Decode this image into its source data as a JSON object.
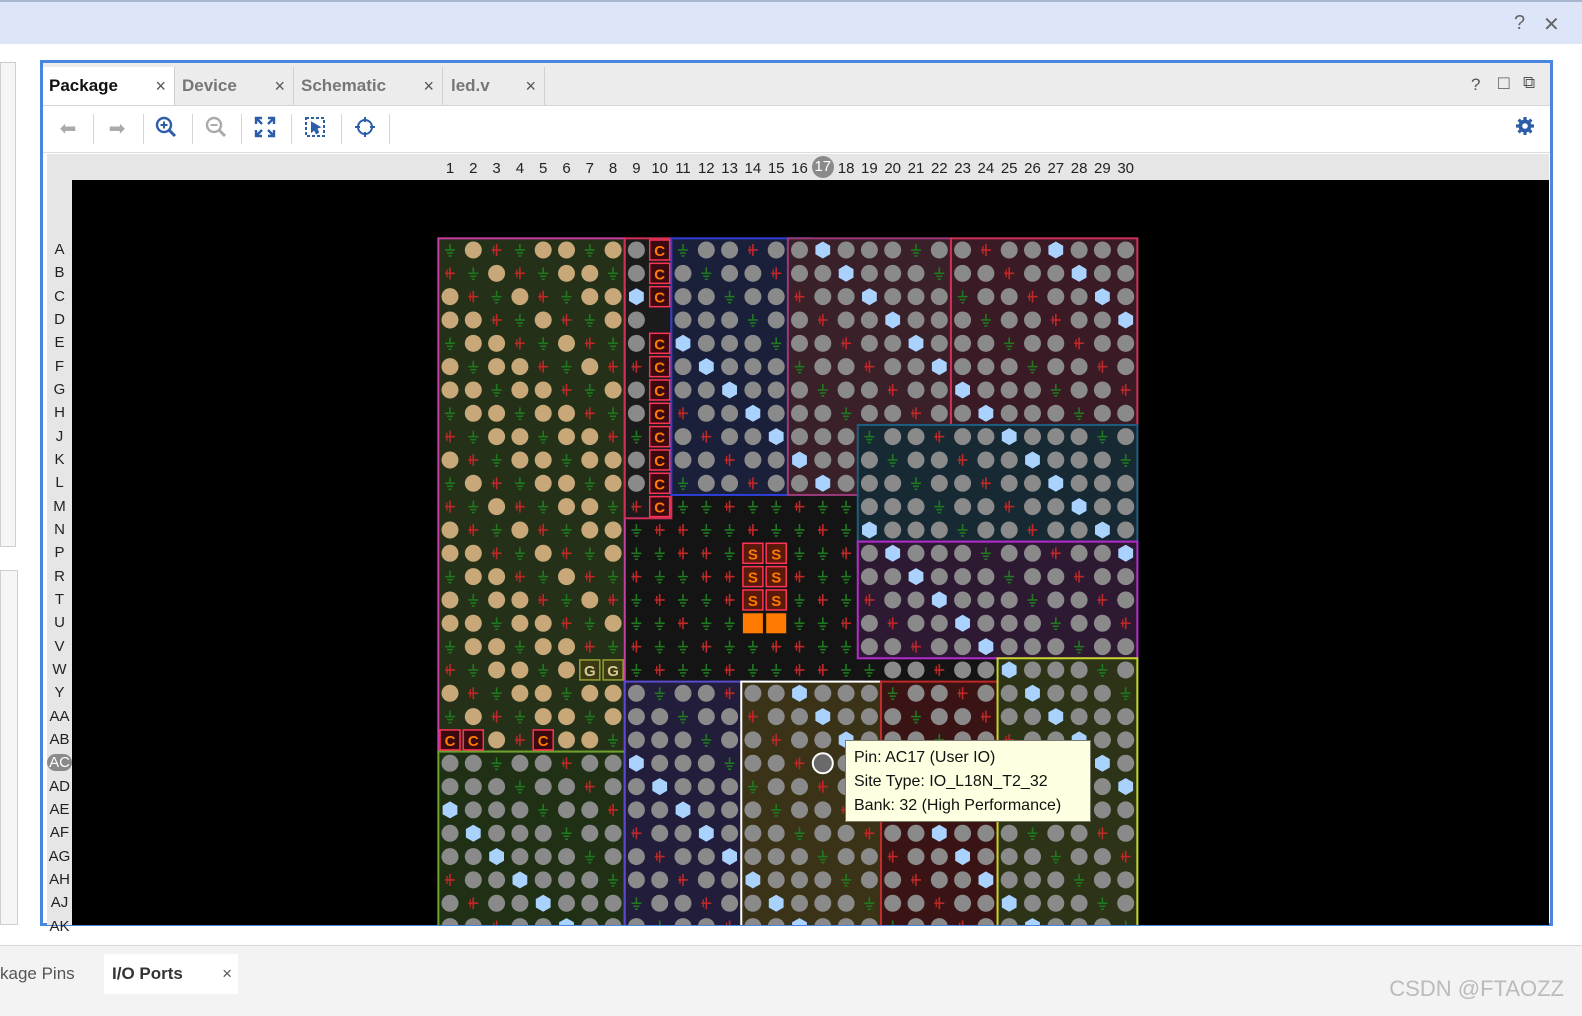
{
  "topbar": {
    "help_icon": "question-icon",
    "close_icon": "close-icon",
    "help_glyph": "?",
    "close_glyph": "✕"
  },
  "tabs": [
    {
      "label": "Package",
      "active": true
    },
    {
      "label": "Device",
      "active": false
    },
    {
      "label": "Schematic",
      "active": false
    },
    {
      "label": "led.v",
      "active": false
    }
  ],
  "panel_controls": {
    "help_glyph": "?",
    "maximize_glyph": "□",
    "float_glyph": "⧉"
  },
  "toolbar": {
    "buttons": [
      "back-arrow-icon",
      "forward-arrow-icon",
      "zoom-in-icon",
      "zoom-out-icon",
      "zoom-fit-icon",
      "select-area-icon",
      "auto-fit-selection-icon"
    ],
    "settings_icon": "gear-icon"
  },
  "package": {
    "columns": [
      "1",
      "2",
      "3",
      "4",
      "5",
      "6",
      "7",
      "8",
      "9",
      "10",
      "11",
      "12",
      "13",
      "14",
      "15",
      "16",
      "17",
      "18",
      "19",
      "20",
      "21",
      "22",
      "23",
      "24",
      "25",
      "26",
      "27",
      "28",
      "29",
      "30"
    ],
    "rows": [
      "A",
      "B",
      "C",
      "D",
      "E",
      "F",
      "G",
      "H",
      "J",
      "K",
      "L",
      "M",
      "N",
      "P",
      "R",
      "T",
      "U",
      "V",
      "W",
      "Y",
      "AA",
      "AB",
      "AC",
      "AD",
      "AE",
      "AF",
      "AG",
      "AH",
      "AJ",
      "AK"
    ],
    "selected_column": "17",
    "selected_row": "AC",
    "config_pin_label": "C",
    "sysmon_pin_label": "S",
    "gt_pin_label": "G"
  },
  "tooltip": {
    "pin": "Pin: AC17 (User IO)",
    "site_type": "Site Type: IO_L18N_T2_32",
    "bank": "Bank: 32 (High Performance)"
  },
  "bottom_tabs": [
    {
      "label": "kage Pins"
    },
    {
      "label": "I/O Ports",
      "active": true
    }
  ],
  "close_glyph": "×",
  "watermark": "CSDN @FTAOZZ",
  "colors": {
    "accent": "#4a86e0",
    "ground": "#1f7a1f",
    "power": "#c02828",
    "io": "#8a8a8a",
    "clock": "#a9d2ff",
    "config": "#ff7a00"
  }
}
